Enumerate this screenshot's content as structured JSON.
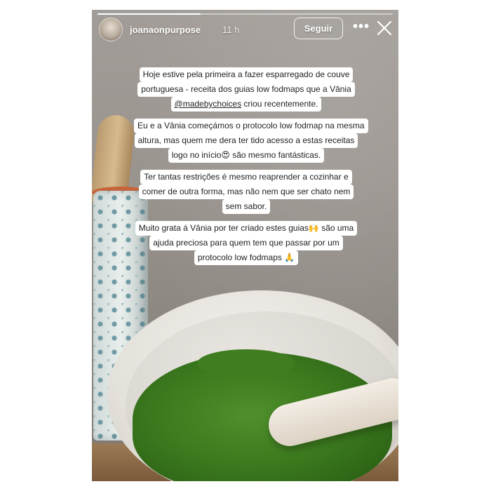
{
  "header": {
    "username": "joanaonpurpose",
    "time": "11 h",
    "follow_label": "Seguir",
    "more_icon": "more-horizontal-icon",
    "close_icon": "close-icon"
  },
  "progress": {
    "fraction": 0.35
  },
  "story_text": {
    "p1": {
      "l1": "Hoje estive pela primeira a fazer esparregado de couve",
      "l2": "portuguesa - receita dos guias low fodmaps que a Vânia",
      "l3_mention": "@madebychoices",
      "l3_rest": " criou recentemente."
    },
    "p2": {
      "l1": "Eu e a Vânia começámos o protocolo low fodmap na mesma",
      "l2": "altura, mas quem me dera ter tido acesso a estas receitas",
      "l3": "logo no início😍 são mesmo fantásticas."
    },
    "p3": {
      "l1": "Ter tantas restrições é mesmo reaprender a cozinhar e",
      "l2": "comer de outra forma, mas não nem que ser chato nem",
      "l3": "sem sabor."
    },
    "p4": {
      "l1": "Muito grata á Vânia por ter criado estes guias🙌 são uma",
      "l2": "ajuda preciosa para quem tem que passar por um",
      "l3": "protocolo low fodmaps 🙏"
    }
  },
  "colors": {
    "puree_green": "#3c7a1e",
    "text_box": "#ffffff",
    "header_text": "#ffffff"
  }
}
